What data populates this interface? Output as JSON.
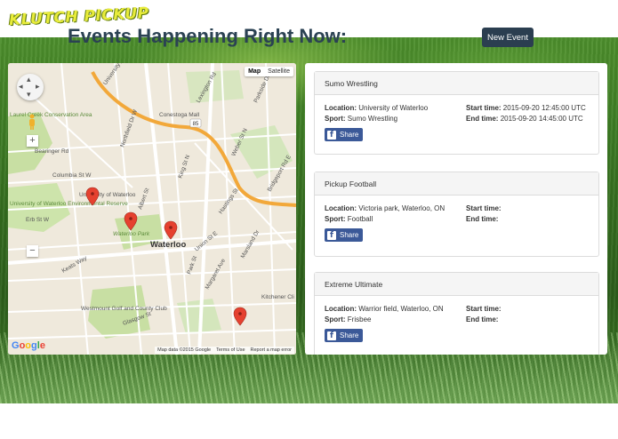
{
  "app": {
    "logo": "KLUTCH PICKUP",
    "title": "Events Happening Right Now:",
    "new_event_label": "New Event"
  },
  "map": {
    "type_options": [
      "Map",
      "Satellite"
    ],
    "selected_type": "Map",
    "google_logo": "Google",
    "footer": [
      "Map data ©2015 Google",
      "Terms of Use",
      "Report a map error"
    ],
    "labels": [
      "Conestoga Mall",
      "Waterloo",
      "Waterloo Park",
      "University of Waterloo",
      "Westmount Golf and County Club",
      "Kitchener Cli",
      "Laurel Creek Conservation Area",
      "University of Waterloo Environmental Reserve",
      "Lexington Rd",
      "Northfield Dr W",
      "Bearinger Rd",
      "Columbia St W",
      "Erb St W",
      "Albert St",
      "Weber St N",
      "King St N",
      "Parkside Dr",
      "Keats Way",
      "Glasgow St",
      "Park St",
      "Union St E",
      "Marsland Dr",
      "Bridgeport Rd E",
      "Margaret Ave",
      "University Ave",
      "Hastings St"
    ],
    "route_shields": [
      "85"
    ],
    "marker_count": 4,
    "colors": {
      "route": "#f2a83a",
      "marker": "#e5412f",
      "park": "#c8dfa3"
    }
  },
  "events": [
    {
      "name": "Sumo Wrestling",
      "location_label": "Location:",
      "location": "University of Waterloo",
      "sport_label": "Sport:",
      "sport": "Sumo Wrestling",
      "start_label": "Start time:",
      "start": "2015-09-20 12:45:00 UTC",
      "end_label": "End time:",
      "end": "2015-09-20 14:45:00 UTC",
      "share_label": "Share"
    },
    {
      "name": "Pickup Football",
      "location_label": "Location:",
      "location": "Victoria park, Waterloo, ON",
      "sport_label": "Sport:",
      "sport": "Football",
      "start_label": "Start time:",
      "start": "",
      "end_label": "End time:",
      "end": "",
      "share_label": "Share"
    },
    {
      "name": "Extreme Ultimate",
      "location_label": "Location:",
      "location": "Warrior field, Waterloo, ON",
      "sport_label": "Sport:",
      "sport": "Frisbee",
      "start_label": "Start time:",
      "start": "",
      "end_label": "End time:",
      "end": "",
      "share_label": "Share"
    }
  ]
}
